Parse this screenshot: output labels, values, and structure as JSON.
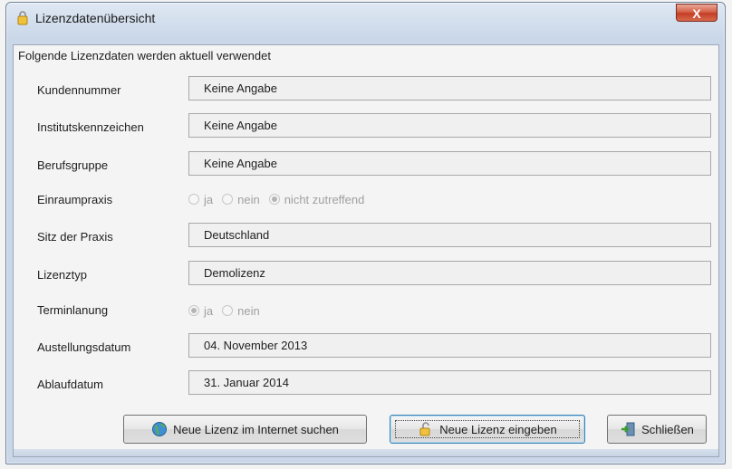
{
  "window": {
    "title": "Lizenzdatenübersicht",
    "close_glyph": "X"
  },
  "header": "Folgende Lizenzdaten werden aktuell verwendet",
  "fields": {
    "kundennummer": {
      "label": "Kundennummer",
      "value": "Keine Angabe"
    },
    "institutskennzeichen": {
      "label": "Institutskennzeichen",
      "value": "Keine Angabe"
    },
    "berufsgruppe": {
      "label": "Berufsgruppe",
      "value": "Keine Angabe"
    },
    "einraumpraxis": {
      "label": "Einraumpraxis",
      "options": [
        "ja",
        "nein",
        "nicht zutreffend"
      ],
      "selected": "nicht zutreffend",
      "enabled": false
    },
    "sitz": {
      "label": "Sitz der Praxis",
      "value": "Deutschland"
    },
    "lizenztyp": {
      "label": "Lizenztyp",
      "value": "Demolizenz"
    },
    "terminlanung": {
      "label": "Terminlanung",
      "options": [
        "ja",
        "nein"
      ],
      "selected": "ja",
      "enabled": false
    },
    "ausstellungsdatum": {
      "label": "Austellungsdatum",
      "value": "04. November 2013"
    },
    "ablaufdatum": {
      "label": "Ablaufdatum",
      "value": "31. Januar 2014"
    }
  },
  "buttons": {
    "search": {
      "label": "Neue Lizenz im Internet suchen",
      "icon": "globe-icon"
    },
    "enter": {
      "label": "Neue Lizenz eingeben",
      "icon": "key-icon"
    },
    "close": {
      "label": "Schließen",
      "icon": "exit-icon"
    }
  },
  "colors": {
    "title_bar": "#c9d7e8",
    "close_button": "#c43d26",
    "focus_border": "#3c7fb1"
  }
}
